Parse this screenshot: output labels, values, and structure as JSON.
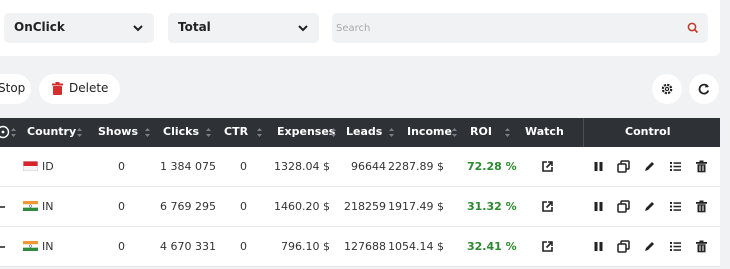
{
  "filters": {
    "type_select": "OnClick",
    "total_select": "Total",
    "search_placeholder": "Search"
  },
  "actions": {
    "stop_label": "Stop",
    "delete_label": "Delete"
  },
  "table": {
    "columns": [
      "Country",
      "Shows",
      "Clicks",
      "CTR",
      "Expenses",
      "Leads",
      "Income",
      "ROI",
      "Watch",
      "Control"
    ],
    "rows": [
      {
        "country": "ID",
        "shows": "0",
        "clicks": "1 384 075",
        "ctr": "0",
        "expenses": "1328.04 $",
        "leads": "96644",
        "income": "2287.89 $",
        "roi": "72.28 %"
      },
      {
        "country": "IN",
        "shows": "0",
        "clicks": "6 769 295",
        "ctr": "0",
        "expenses": "1460.20 $",
        "leads": "218259",
        "income": "1917.49 $",
        "roi": "31.32 %"
      },
      {
        "country": "IN",
        "shows": "0",
        "clicks": "4 670 331",
        "ctr": "0",
        "expenses": "796.10 $",
        "leads": "127688",
        "income": "1054.14 $",
        "roi": "32.41 %"
      }
    ]
  },
  "colors": {
    "header_bg": "#2e3237",
    "roi_positive": "#2a8a2e",
    "delete_icon": "#d32f2f",
    "page_bg": "#f1f2f4"
  },
  "icons": {
    "watch": "external-link-icon",
    "control": [
      "pause-icon",
      "copy-icon",
      "edit-icon",
      "list-icon",
      "trash-icon"
    ]
  }
}
